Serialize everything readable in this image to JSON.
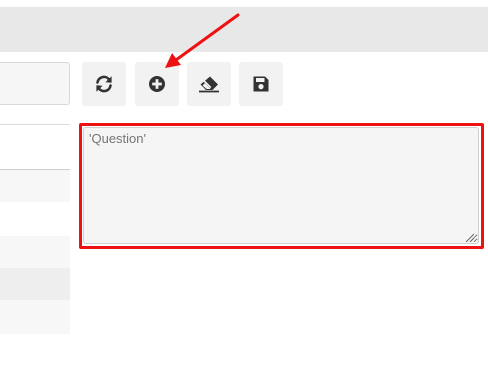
{
  "question": {
    "placeholder": "'Question'",
    "value": ""
  },
  "toolbar": {
    "buttons": [
      {
        "icon": "refresh-icon"
      },
      {
        "icon": "plus-circle-icon"
      },
      {
        "icon": "eraser-icon"
      },
      {
        "icon": "save-icon"
      }
    ]
  },
  "colors": {
    "highlight": "#ee1111",
    "icon": "#333333",
    "button_bg": "#f2f2f2"
  }
}
